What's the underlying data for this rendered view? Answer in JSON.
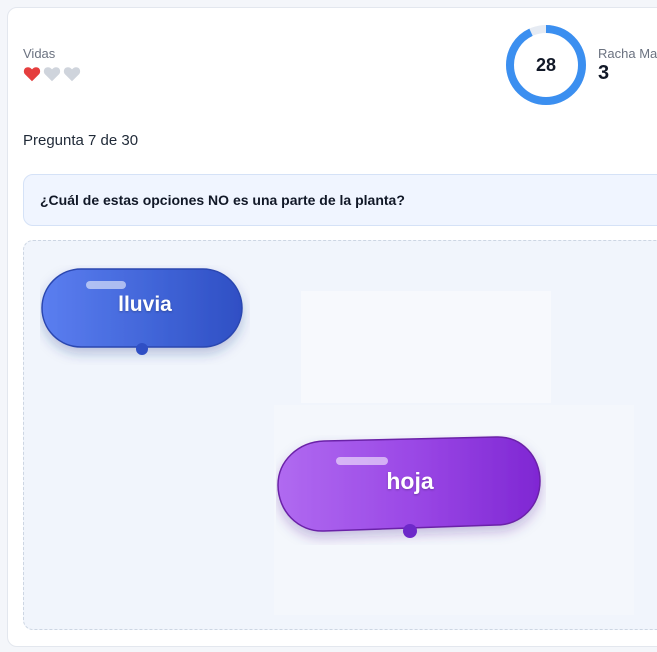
{
  "lives": {
    "label": "Vidas",
    "hearts": [
      "filled",
      "empty",
      "empty"
    ],
    "colors": {
      "filled": "#e53e3e",
      "empty": "#cfd4dc"
    }
  },
  "timer": {
    "value": "28",
    "fraction_remaining": 0.93,
    "color": "#3b8ff0"
  },
  "streak": {
    "label": "Racha Ma",
    "value": "3"
  },
  "progress": {
    "text": "Pregunta 7 de 30"
  },
  "question": {
    "text": "¿Cuál de estas opciones NO es una parte de la planta?"
  },
  "answers": [
    {
      "label": "lluvia",
      "color": "#3f63d6",
      "icon": "pill-button"
    },
    {
      "label": "hoja",
      "color": "#8a35d9",
      "icon": "pill-button"
    }
  ]
}
